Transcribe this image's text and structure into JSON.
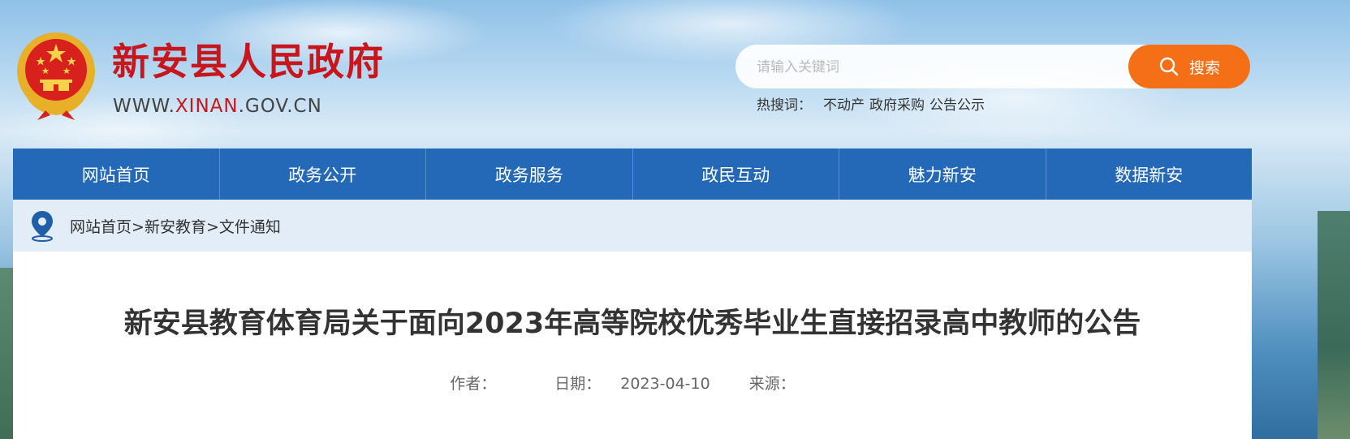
{
  "header": {
    "site_title": "新安县人民政府",
    "site_url_prefix": "WWW.",
    "site_url_highlight": "XINAN",
    "site_url_suffix": ".GOV.CN",
    "emblem_icon": "national-emblem-icon"
  },
  "search": {
    "placeholder": "请输入关键词",
    "value": "",
    "button_label": "搜索",
    "button_icon": "search-icon",
    "accent_color": "#f46f16"
  },
  "hot_search": {
    "label": "热搜词：",
    "keywords": [
      "不动产",
      "政府采购",
      "公告公示"
    ]
  },
  "nav": {
    "color": "#2369b7",
    "items": [
      {
        "label": "网站首页"
      },
      {
        "label": "政务公开"
      },
      {
        "label": "政务服务"
      },
      {
        "label": "政民互动"
      },
      {
        "label": "魅力新安"
      },
      {
        "label": "数据新安"
      }
    ]
  },
  "breadcrumb": {
    "icon": "location-pin-icon",
    "items": [
      "网站首页",
      "新安教育",
      "文件通知"
    ],
    "separator": ">"
  },
  "article": {
    "title": "新安县教育体育局关于面向2023年高等院校优秀毕业生直接招录高中教师的公告",
    "author_label": "作者：",
    "author": "",
    "date_label": "日期：",
    "date": "2023-04-10",
    "source_label": "来源：",
    "source": ""
  }
}
